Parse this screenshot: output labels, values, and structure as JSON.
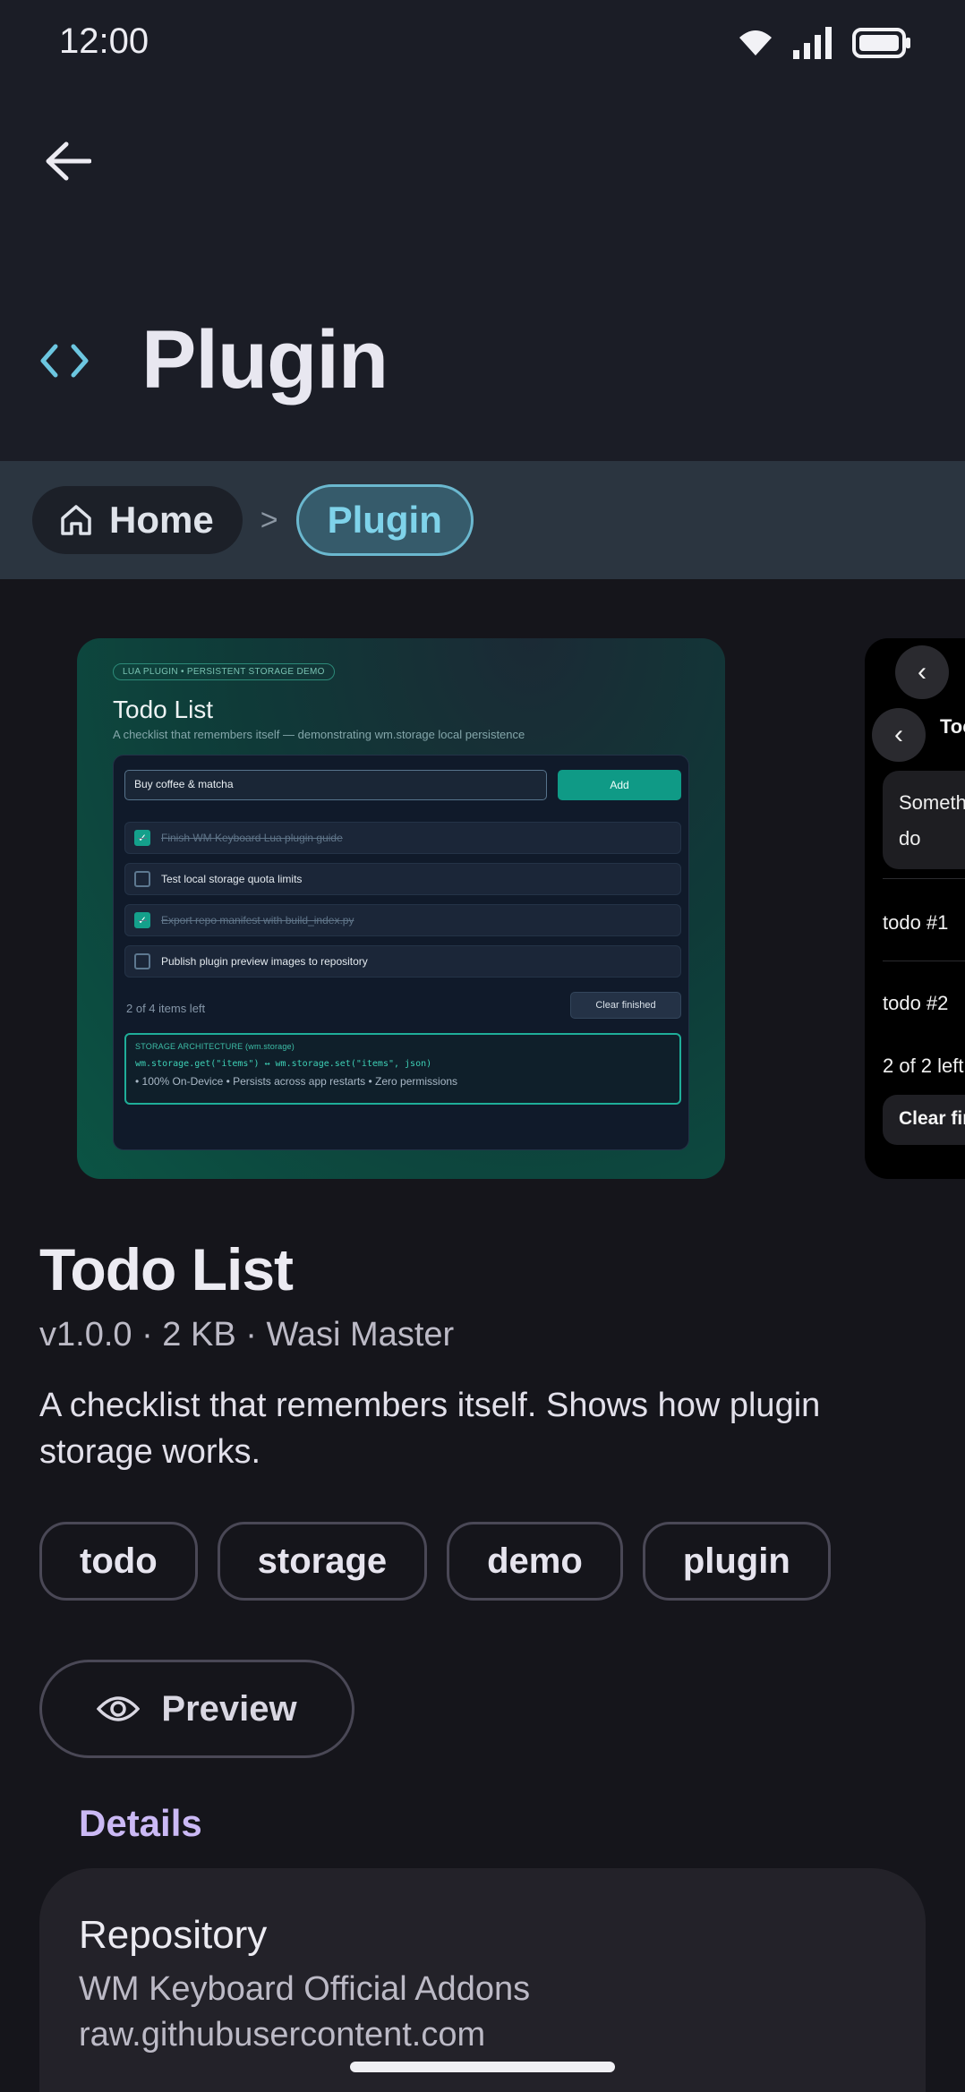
{
  "status_bar": {
    "time": "12:00",
    "icons": [
      "wifi-icon",
      "signal-icon",
      "battery-icon"
    ]
  },
  "app_bar": {
    "title": "Plugin",
    "title_icon": "code-brackets-icon",
    "back_icon": "arrow-left-icon"
  },
  "breadcrumb": {
    "home": "Home",
    "separator": ">",
    "current": "Plugin"
  },
  "preview1": {
    "badge": "LUA PLUGIN  •  PERSISTENT STORAGE DEMO",
    "title": "Todo List",
    "subtitle": "A checklist that remembers itself — demonstrating wm.storage local persistence",
    "input_value": "Buy coffee & matcha",
    "add_label": "Add",
    "items": [
      {
        "text": "Finish WM Keyboard Lua plugin guide",
        "done": true
      },
      {
        "text": "Test local storage quota limits",
        "done": false
      },
      {
        "text": "Export repo manifest with build_index.py",
        "done": true
      },
      {
        "text": "Publish plugin preview images to repository",
        "done": false
      }
    ],
    "count": "2 of 4 items left",
    "clear_label": "Clear finished",
    "storage_heading": "STORAGE ARCHITECTURE (wm.storage)",
    "storage_code": "wm.storage.get(\"items\")  ↔  wm.storage.set(\"items\", json)",
    "storage_features": "• 100% On-Device  • Persists across app restarts  • Zero permissions"
  },
  "preview2": {
    "title": "Toc",
    "box_text_1": "Someth",
    "box_text_2": "do",
    "item1": "todo #1",
    "item2": "todo #2",
    "count": "2 of 2 left",
    "clear": "Clear fir"
  },
  "plugin": {
    "name": "Todo List",
    "meta": "v1.0.0 · 2 KB · Wasi Master",
    "description": "A checklist that remembers itself. Shows how plugin storage works.",
    "tags": [
      "todo",
      "storage",
      "demo",
      "plugin"
    ],
    "preview_label": "Preview"
  },
  "details": {
    "heading": "Details",
    "repo_label": "Repository",
    "repo_name": "WM Keyboard Official Addons",
    "repo_host": "raw.githubusercontent.com"
  },
  "colors": {
    "accent_teal": "#0f9a86",
    "accent_purple": "#cbb9f5",
    "crumb_accent": "#7fd3ea"
  }
}
